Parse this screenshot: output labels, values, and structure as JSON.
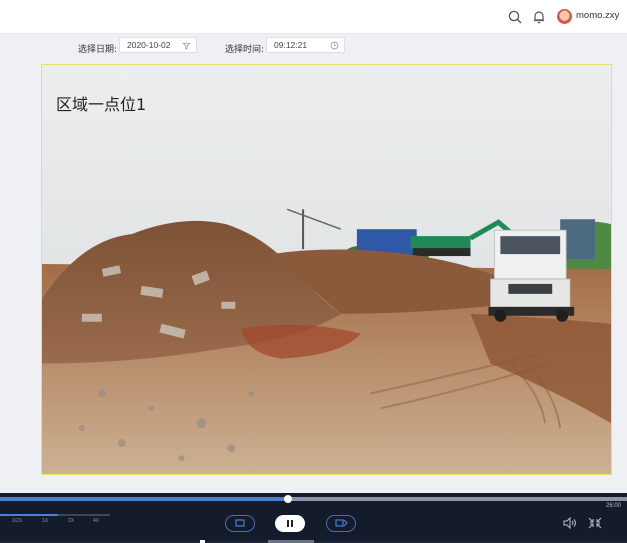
{
  "header": {
    "username": "momo.zxy",
    "icons": [
      "search-icon",
      "bell-icon",
      "avatar"
    ]
  },
  "filters": {
    "date_label": "选择日期:",
    "date_value": "2020-10-02",
    "time_label": "选择时间:",
    "time_value": "09:12:21"
  },
  "video": {
    "title": "区域一点位1"
  },
  "player": {
    "progress": 0.46,
    "end_time": "26:00",
    "speed_options": [
      "1/2X",
      "1X",
      "2X",
      "4X"
    ],
    "speed_selected": "2X",
    "accent_color": "#4a7fd4",
    "icons": [
      "prev-frame-icon",
      "pause-icon",
      "next-frame-icon",
      "volume-icon",
      "fullscreen-icon"
    ]
  }
}
